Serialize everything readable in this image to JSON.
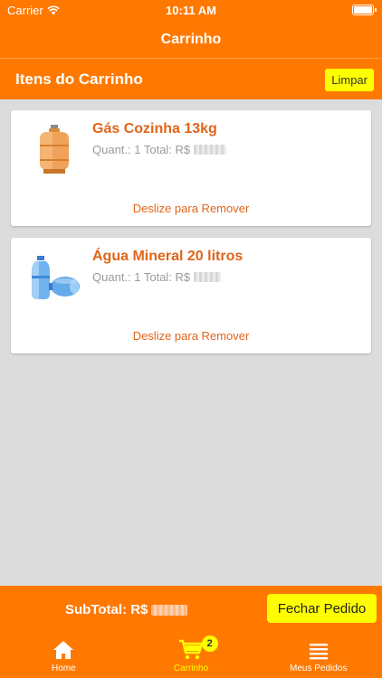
{
  "status_bar": {
    "carrier": "Carrier",
    "time": "10:11 AM"
  },
  "nav": {
    "title": "Carrinho"
  },
  "section": {
    "title": "Itens do Carrinho",
    "clear_label": "Limpar"
  },
  "cart_items": [
    {
      "name": "Gás Cozinha 13kg",
      "quantity_label": "Quant.: 1 Total: R$",
      "swipe_hint": "Deslize para Remover",
      "icon": "gas-cylinder-icon"
    },
    {
      "name": "Água Mineral 20 litros",
      "quantity_label": "Quant.: 1 Total: R$",
      "swipe_hint": "Deslize para Remover",
      "icon": "water-jug-icon"
    }
  ],
  "footer": {
    "subtotal_label": "SubTotal: R$",
    "checkout_label": "Fechar Pedido"
  },
  "tabs": [
    {
      "label": "Home",
      "icon": "home-icon",
      "active": false
    },
    {
      "label": "Carrinho",
      "icon": "cart-icon",
      "active": true,
      "badge": "2"
    },
    {
      "label": "Meus Pedidos",
      "icon": "list-icon",
      "active": false
    }
  ],
  "colors": {
    "brand_orange": "#ff7900",
    "accent_yellow": "#ffff00",
    "item_text_orange": "#e0651a"
  }
}
